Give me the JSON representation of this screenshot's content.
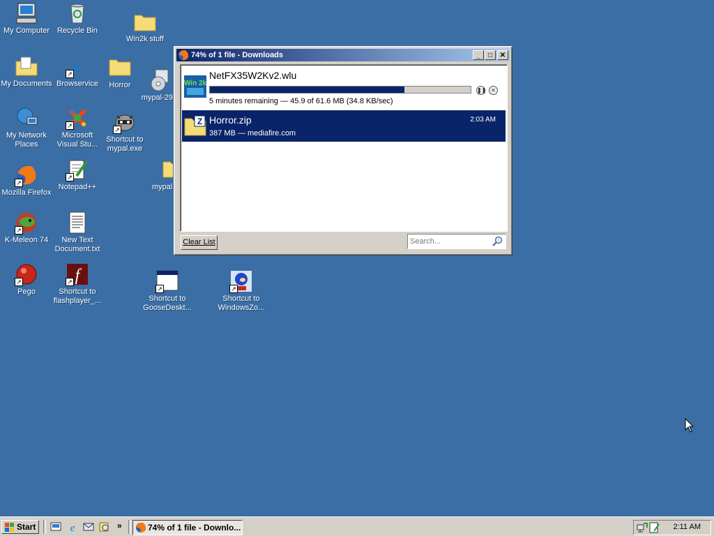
{
  "desktop": {
    "icons": [
      {
        "label": "My Computer",
        "icon": "computer-icon"
      },
      {
        "label": "Recycle Bin",
        "icon": "recycle-bin-icon"
      },
      {
        "label": "Win2k stuff",
        "icon": "folder-icon"
      },
      {
        "label": "My Documents",
        "icon": "documents-folder-icon"
      },
      {
        "label": "Browservice",
        "icon": "ie-icon"
      },
      {
        "label": "Horror",
        "icon": "folder-icon"
      },
      {
        "label": "mypal-29.3",
        "icon": "installer-icon"
      },
      {
        "label": "My Network Places",
        "icon": "network-icon"
      },
      {
        "label": "Microsoft Visual Stu...",
        "icon": "visual-studio-icon"
      },
      {
        "label": "Shortcut to mypal.exe",
        "icon": "raccoon-icon"
      },
      {
        "label": "Mozilla Firefox",
        "icon": "firefox-icon"
      },
      {
        "label": "Notepad++",
        "icon": "notepadpp-icon"
      },
      {
        "label": "mypal-",
        "icon": "folder-icon"
      },
      {
        "label": "K-Meleon 74",
        "icon": "kmeleon-icon"
      },
      {
        "label": "New Text Document.txt",
        "icon": "text-document-icon"
      },
      {
        "label": "Pego",
        "icon": "pego-icon"
      },
      {
        "label": "Shortcut to flashplayer_...",
        "icon": "flash-icon"
      },
      {
        "label": "Shortcut to GooseDeskt...",
        "icon": "window-app-icon"
      },
      {
        "label": "Shortcut to WindowsZo...",
        "icon": "sonic-icon"
      }
    ]
  },
  "downloads_window": {
    "title": "74% of 1 file - Downloads",
    "buttons": {
      "minimize": "_",
      "maximize": "□",
      "close": "✕"
    },
    "items": [
      {
        "filename": "NetFX35W2Kv2.wlu",
        "status": "5 minutes remaining — 45.9 of 61.6 MB (34.8 KB/sec)",
        "progress": 0.745,
        "icon_text": "Win 2k"
      },
      {
        "filename": "Horror.zip",
        "status": "387 MB — mediafire.com",
        "time": "2:03 AM",
        "icon_text": "Z"
      }
    ],
    "clear_list_label": "Clear List",
    "search_placeholder": "Search..."
  },
  "taskbar": {
    "start_label": "Start",
    "active_task_label": "74% of 1 file - Downlo...",
    "clock": "2:11 AM",
    "quicklaunch_more": "»"
  },
  "colors": {
    "desktop": "#3a6ea5",
    "titlebar_start": "#0a246a",
    "titlebar_end": "#a6caf0",
    "selection": "#0a246a"
  }
}
